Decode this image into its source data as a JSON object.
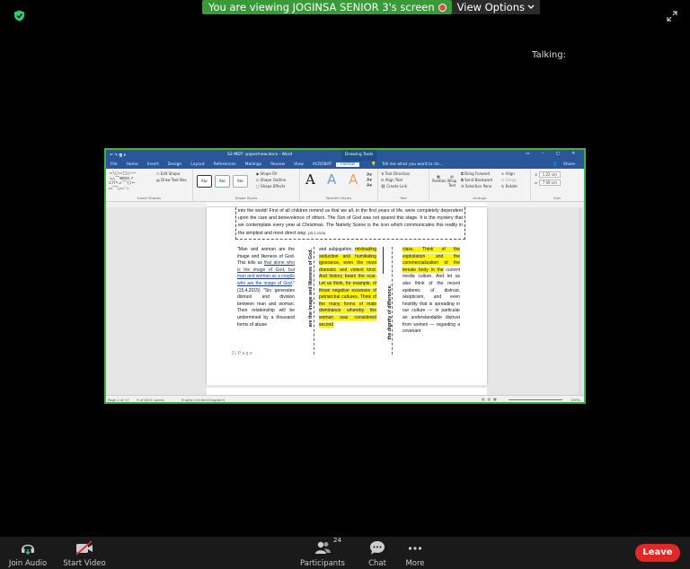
{
  "banner": {
    "viewing_text": "You are viewing JOGINSA SENIOR 3's screen",
    "view_options_label": "View Options",
    "colors": {
      "banner": "#3a9a3a",
      "security": "#2ecc71"
    }
  },
  "talking_label": "Talking:",
  "word": {
    "title": "S2-MDT -paper/new.docx - Word",
    "contextual_tab": "Drawing Tools",
    "tabs": [
      "File",
      "Home",
      "Insert",
      "Design",
      "Layout",
      "References",
      "Mailings",
      "Review",
      "View",
      "ACROBAT",
      "Format"
    ],
    "active_tab": "Format",
    "tell_me": "Tell me what you want to do...",
    "share_label": "Share",
    "ribbon": {
      "edit_shape": "Edit Shape",
      "draw_text_box": "Draw Text Box",
      "insert_shapes_label": "Insert Shapes",
      "style_samples": [
        "Abc",
        "Abc",
        "Abc"
      ],
      "shape_fill": "Shape Fill",
      "shape_outline": "Shape Outline",
      "shape_effects": "Shape Effects",
      "shape_styles_label": "Shape Styles",
      "wordart_letters": [
        "A",
        "A",
        "A"
      ],
      "wordart_label": "WordArt Styles",
      "text_direction": "Text Direction",
      "align_text": "Align Text",
      "create_link": "Create Link",
      "text_label": "Text",
      "position": "Position",
      "wrap_text": "Wrap Text",
      "bring_forward": "Bring Forward",
      "send_backward": "Send Backward",
      "selection_pane": "Selection Pane",
      "align": "Align",
      "group": "Group",
      "rotate": "Rotate",
      "arrange_label": "Arrange",
      "height": "1.22 cm",
      "width": "7.09 cm",
      "size_label": "Size"
    },
    "document": {
      "quote_text": "into the world! First of all children remind us that we all, in the first years of life, were completely dependent upon the care and benevolence of others. The Son of God was not spared this stage. It is the mystery that we contemplate every year at Christmas. The Nativity Scene is the icon which communicates this reality in the simplest and most direct way.",
      "quote_ref": "(15.3.2015)",
      "col1_pre": "\"Man and woman are the image and likeness of God. This tells us ",
      "col1_link": "that alone who is the image of God, but man and woman as a couple who are the image of God",
      "col1_post": ".\" (15.4.2015) \"Sin generates distrust and division between man and woman. Their relationship will be undermined by a thousand forms of abuse",
      "vert1": "are the image and likeness of God.",
      "col2_pre": "and subjugation, ",
      "col2_hl": "misleading seduction and humiliating ignorance, even the most dramatic and violent kind. And history bears the scar. Let us think, for example, of those negative excesses of patriarchal cultures. Think of the many forms of male dominance whereby the woman was considered second",
      "vert2": "the dignity of difference.",
      "col3_hl": "class. Think of the exploitation and the commercialization of the female body in the",
      "col3_post": " current media culture. And let us also think of the recent epidemic of distrust, skepticism, and even hostility that is spreading in our culture — in particular an understandable distrust from women — regarding a covenant",
      "page_number": "2 | P a g e"
    },
    "status": {
      "page": "Page 2 of 17",
      "words": "5 of 8201 words",
      "language": "English (United Kingdom)",
      "zoom": "100%"
    }
  },
  "toolbar": {
    "join_audio": "Join Audio",
    "start_video": "Start Video",
    "participants": "Participants",
    "participants_count": "24",
    "chat": "Chat",
    "more": "More",
    "leave": "Leave",
    "leave_color": "#e02828"
  }
}
